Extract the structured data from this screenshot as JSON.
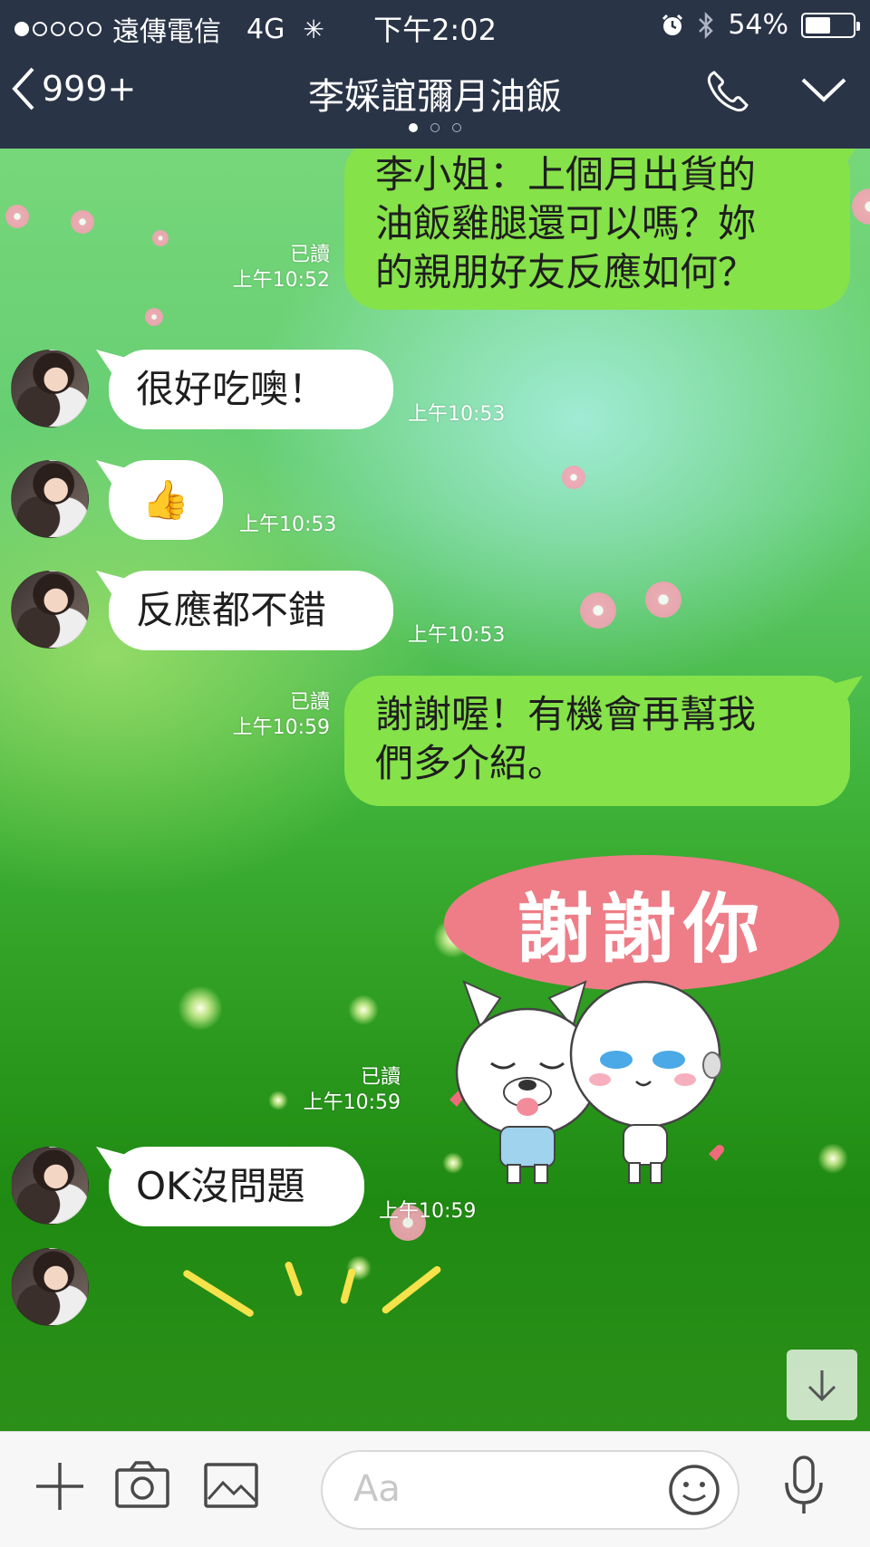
{
  "status_bar": {
    "carrier": "遠傳電信",
    "network": "4G",
    "time": "下午2:02",
    "battery": "54%",
    "battery_level": 0.54,
    "signal_bars_filled": 1,
    "signal_bars_total": 5
  },
  "header": {
    "back_label": "999+",
    "title": "李婇誼彌月油飯",
    "pages": 3,
    "active_page": 1
  },
  "messages": [
    {
      "dir": "out",
      "text": "李小姐：上個月出貨的\n油飯雞腿還可以嗎？妳\n的親朋好友反應如何？",
      "read": "已讀",
      "time": "上午10:52"
    },
    {
      "dir": "in",
      "text": "很好吃噢！",
      "time": "上午10:53"
    },
    {
      "dir": "in",
      "text": "👍",
      "time": "上午10:53"
    },
    {
      "dir": "in",
      "text": "反應都不錯",
      "time": "上午10:53"
    },
    {
      "dir": "out",
      "text": "謝謝喔！有機會再幫我\n們多介紹。",
      "read": "已讀",
      "time": "上午10:59"
    },
    {
      "dir": "out",
      "type": "sticker",
      "text": "謝謝你",
      "read": "已讀",
      "time": "上午10:59"
    },
    {
      "dir": "in",
      "text": "OK沒問題",
      "time": "上午10:59"
    }
  ],
  "input": {
    "placeholder": "Aa"
  },
  "colors": {
    "header_bg": "#2a3447",
    "outgoing_bubble": "#85e249",
    "incoming_bubble": "#ffffff",
    "sticker_banner": "#ee7d87"
  },
  "icons": [
    "plus-icon",
    "camera-icon",
    "image-icon",
    "smiley-icon",
    "microphone-icon",
    "phone-icon",
    "chevron-down-icon",
    "back-chevron-icon",
    "arrow-down-icon",
    "alarm-icon",
    "bluetooth-icon",
    "battery-icon"
  ]
}
